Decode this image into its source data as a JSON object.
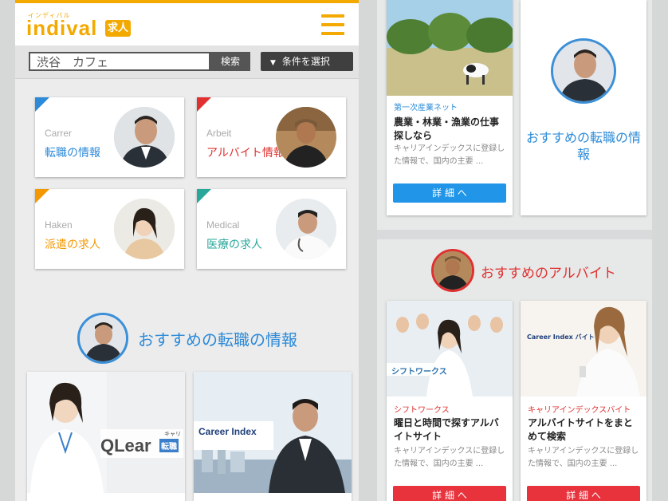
{
  "header": {
    "logo_small": "インディバル",
    "logo_main": "indival",
    "logo_badge": "求人",
    "colors": {
      "accent": "#f3a900"
    }
  },
  "search": {
    "value": "渋谷　カフェ",
    "button_label": "検索",
    "condition_label": "条件を選択"
  },
  "categories": [
    {
      "en": "Carrer",
      "ja": "転職の情報",
      "color": "#2c8ad8"
    },
    {
      "en": "Arbeit",
      "ja": "アルバイト情報",
      "color": "#e03030"
    },
    {
      "en": "Haken",
      "ja": "派遣の求人",
      "color": "#f39800"
    },
    {
      "en": "Medical",
      "ja": "医療の求人",
      "color": "#2aa79b"
    }
  ],
  "recommended_career": {
    "title": "おすすめの転職の情報",
    "cards": [
      {
        "logo": "QLear",
        "logo_sub": "キャリア",
        "logo_badge": "転職"
      },
      {
        "logo": "Career Index"
      }
    ]
  },
  "right": {
    "job_top": {
      "company": "第一次産業ネット",
      "title": "農業・林業・漁業の仕事探しなら",
      "desc": "キャリアインデックスに登録した情報で、国内の主要 ...",
      "button": "詳 細 へ"
    },
    "rec_side_title": "おすすめの転職の情報",
    "baito_title": "おすすめのアルバイト",
    "baito_cards": [
      {
        "company": "シフトワークス",
        "logo": "シフトワークス",
        "title": "曜日と時間で探すアルバイトサイト",
        "desc": "キャリアインデックスに登録した情報で、国内の主要 ...",
        "button": "詳 細 へ"
      },
      {
        "company": "キャリアインデックスバイト",
        "logo": "Career Index バイト",
        "title": "アルバイトサイトをまとめて検索",
        "desc": "キャリアインデックスに登録した情報で、国内の主要 ...",
        "button": "詳 細 へ"
      }
    ]
  }
}
